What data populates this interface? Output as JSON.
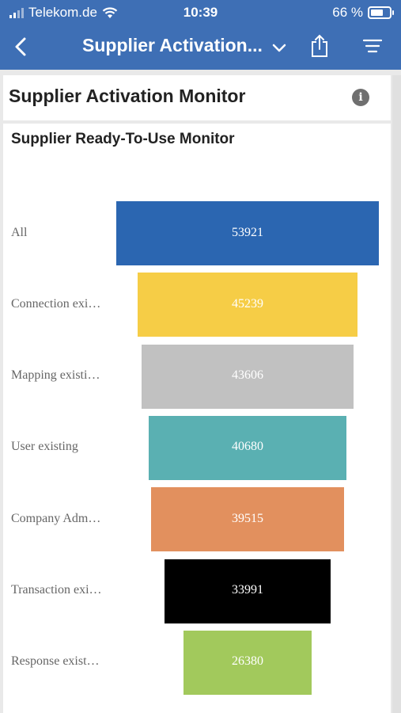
{
  "status_bar": {
    "carrier": "Telekom.de",
    "time": "10:39",
    "battery": "66 %",
    "battery_level": 0.66,
    "signal_bars": 4,
    "signal_strength": 2
  },
  "nav": {
    "back_icon": "chevron-left-icon",
    "title": "Supplier Activation...",
    "dropdown_icon": "chevron-down-icon",
    "share_icon": "share-icon",
    "menu_icon": "filter-lines-icon"
  },
  "header": {
    "title": "Supplier Activation Monitor",
    "info_icon": "info-icon",
    "info_glyph": "i"
  },
  "chart_card": {
    "title": "Supplier Ready-To-Use Monitor"
  },
  "chart_data": {
    "type": "funnel",
    "title": "Supplier Ready-To-Use Monitor",
    "categories": [
      "All",
      "Connection exi…",
      "Mapping existi…",
      "User existing",
      "Company Adm…",
      "Transaction exi…",
      "Response exist…"
    ],
    "values": [
      53921,
      45239,
      43606,
      40680,
      39515,
      33991,
      26380
    ],
    "data_labels": [
      "53921",
      "45239",
      "43606",
      "40680",
      "39515",
      "33991",
      "26380"
    ],
    "colors": [
      "#2b66b1",
      "#f6cd46",
      "#c1c1c1",
      "#5ab0b2",
      "#e2905e",
      "#000000",
      "#a2c95c"
    ]
  }
}
